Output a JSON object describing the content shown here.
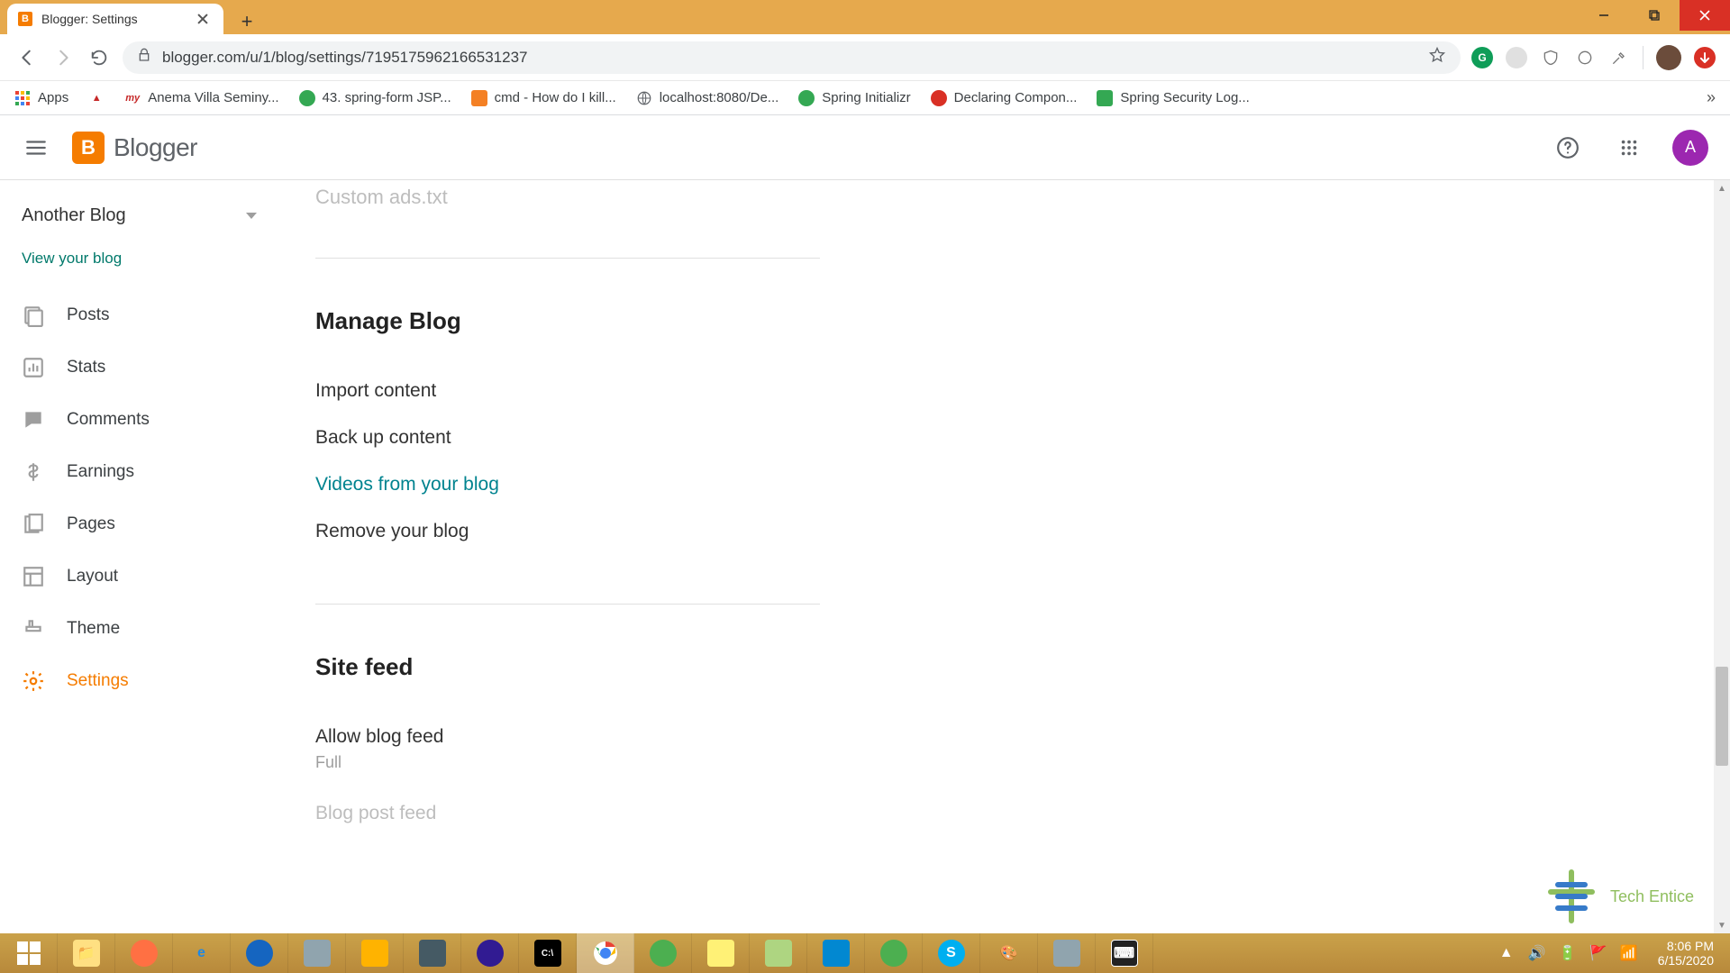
{
  "window": {
    "tab_title": "Blogger: Settings",
    "url": "blogger.com/u/1/blog/settings/7195175962166531237"
  },
  "bookmarks": {
    "apps": "Apps",
    "items": [
      {
        "label": "Anema Villa Seminy..."
      },
      {
        "label": "43. spring-form JSP..."
      },
      {
        "label": "cmd - How do I kill..."
      },
      {
        "label": "localhost:8080/De..."
      },
      {
        "label": "Spring Initializr"
      },
      {
        "label": "Declaring Compon..."
      },
      {
        "label": "Spring Security Log..."
      }
    ]
  },
  "header": {
    "brand": "Blogger",
    "avatar_initial": "A"
  },
  "sidebar": {
    "blog_selector": "Another Blog",
    "view_link": "View your blog",
    "items": [
      {
        "label": "Posts"
      },
      {
        "label": "Stats"
      },
      {
        "label": "Comments"
      },
      {
        "label": "Earnings"
      },
      {
        "label": "Pages"
      },
      {
        "label": "Layout"
      },
      {
        "label": "Theme"
      },
      {
        "label": "Settings"
      }
    ]
  },
  "settings": {
    "prev_section_tail": "Custom ads.txt",
    "manage": {
      "title": "Manage Blog",
      "import": "Import content",
      "backup": "Back up content",
      "videos": "Videos from your blog",
      "remove": "Remove your blog"
    },
    "sitefeed": {
      "title": "Site feed",
      "allow": "Allow blog feed",
      "allow_value": "Full",
      "postfeed": "Blog post feed"
    }
  },
  "watermark": {
    "text": "Tech Entice"
  },
  "taskbar": {
    "time": "8:06 PM",
    "date": "6/15/2020"
  }
}
